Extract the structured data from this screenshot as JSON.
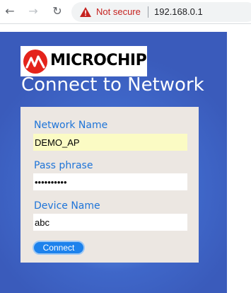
{
  "browser": {
    "security_label": "Not secure",
    "url": "192.168.0.1",
    "icons": {
      "back": "back-arrow-icon",
      "forward": "forward-arrow-icon",
      "reload": "reload-icon",
      "security": "warning-icon"
    }
  },
  "header": {
    "logo_text": "MICROCHIP",
    "title": "Connect to Network"
  },
  "form": {
    "network_name": {
      "label": "Network Name",
      "value": "DEMO_AP"
    },
    "pass_phrase": {
      "label": "Pass phrase",
      "value": "••••••••••"
    },
    "device_name": {
      "label": "Device Name",
      "value": "abc"
    },
    "connect_label": "Connect"
  },
  "colors": {
    "accent": "#1e74d8",
    "button": "#1d82ec",
    "card": "#ece7e2",
    "autofill": "#fbfbc4",
    "security_warning": "#c5221f"
  }
}
